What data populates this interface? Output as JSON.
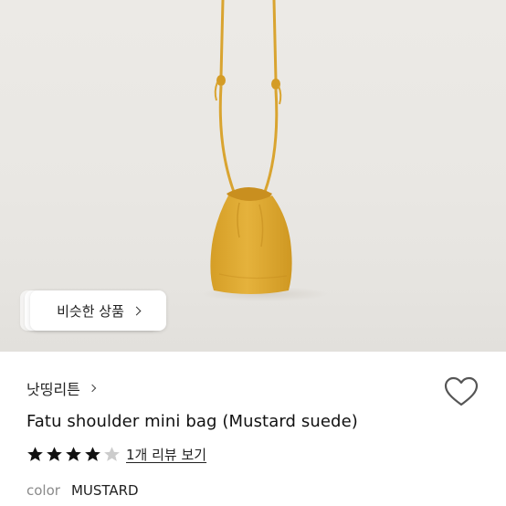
{
  "hero": {
    "similar_button_label": "비슷한 상품",
    "bag_color": "#E2AE36"
  },
  "product": {
    "shop_name": "낫띵리튼",
    "title": "Fatu shoulder mini bag (Mustard suede)",
    "rating": 4,
    "rating_max": 5,
    "review_link": "1개 리뷰 보기",
    "color_label": "color",
    "color_value": "MUSTARD"
  },
  "colors": {
    "star_filled": "#111111",
    "star_empty": "#cccccc",
    "heart_stroke": "#555555"
  }
}
